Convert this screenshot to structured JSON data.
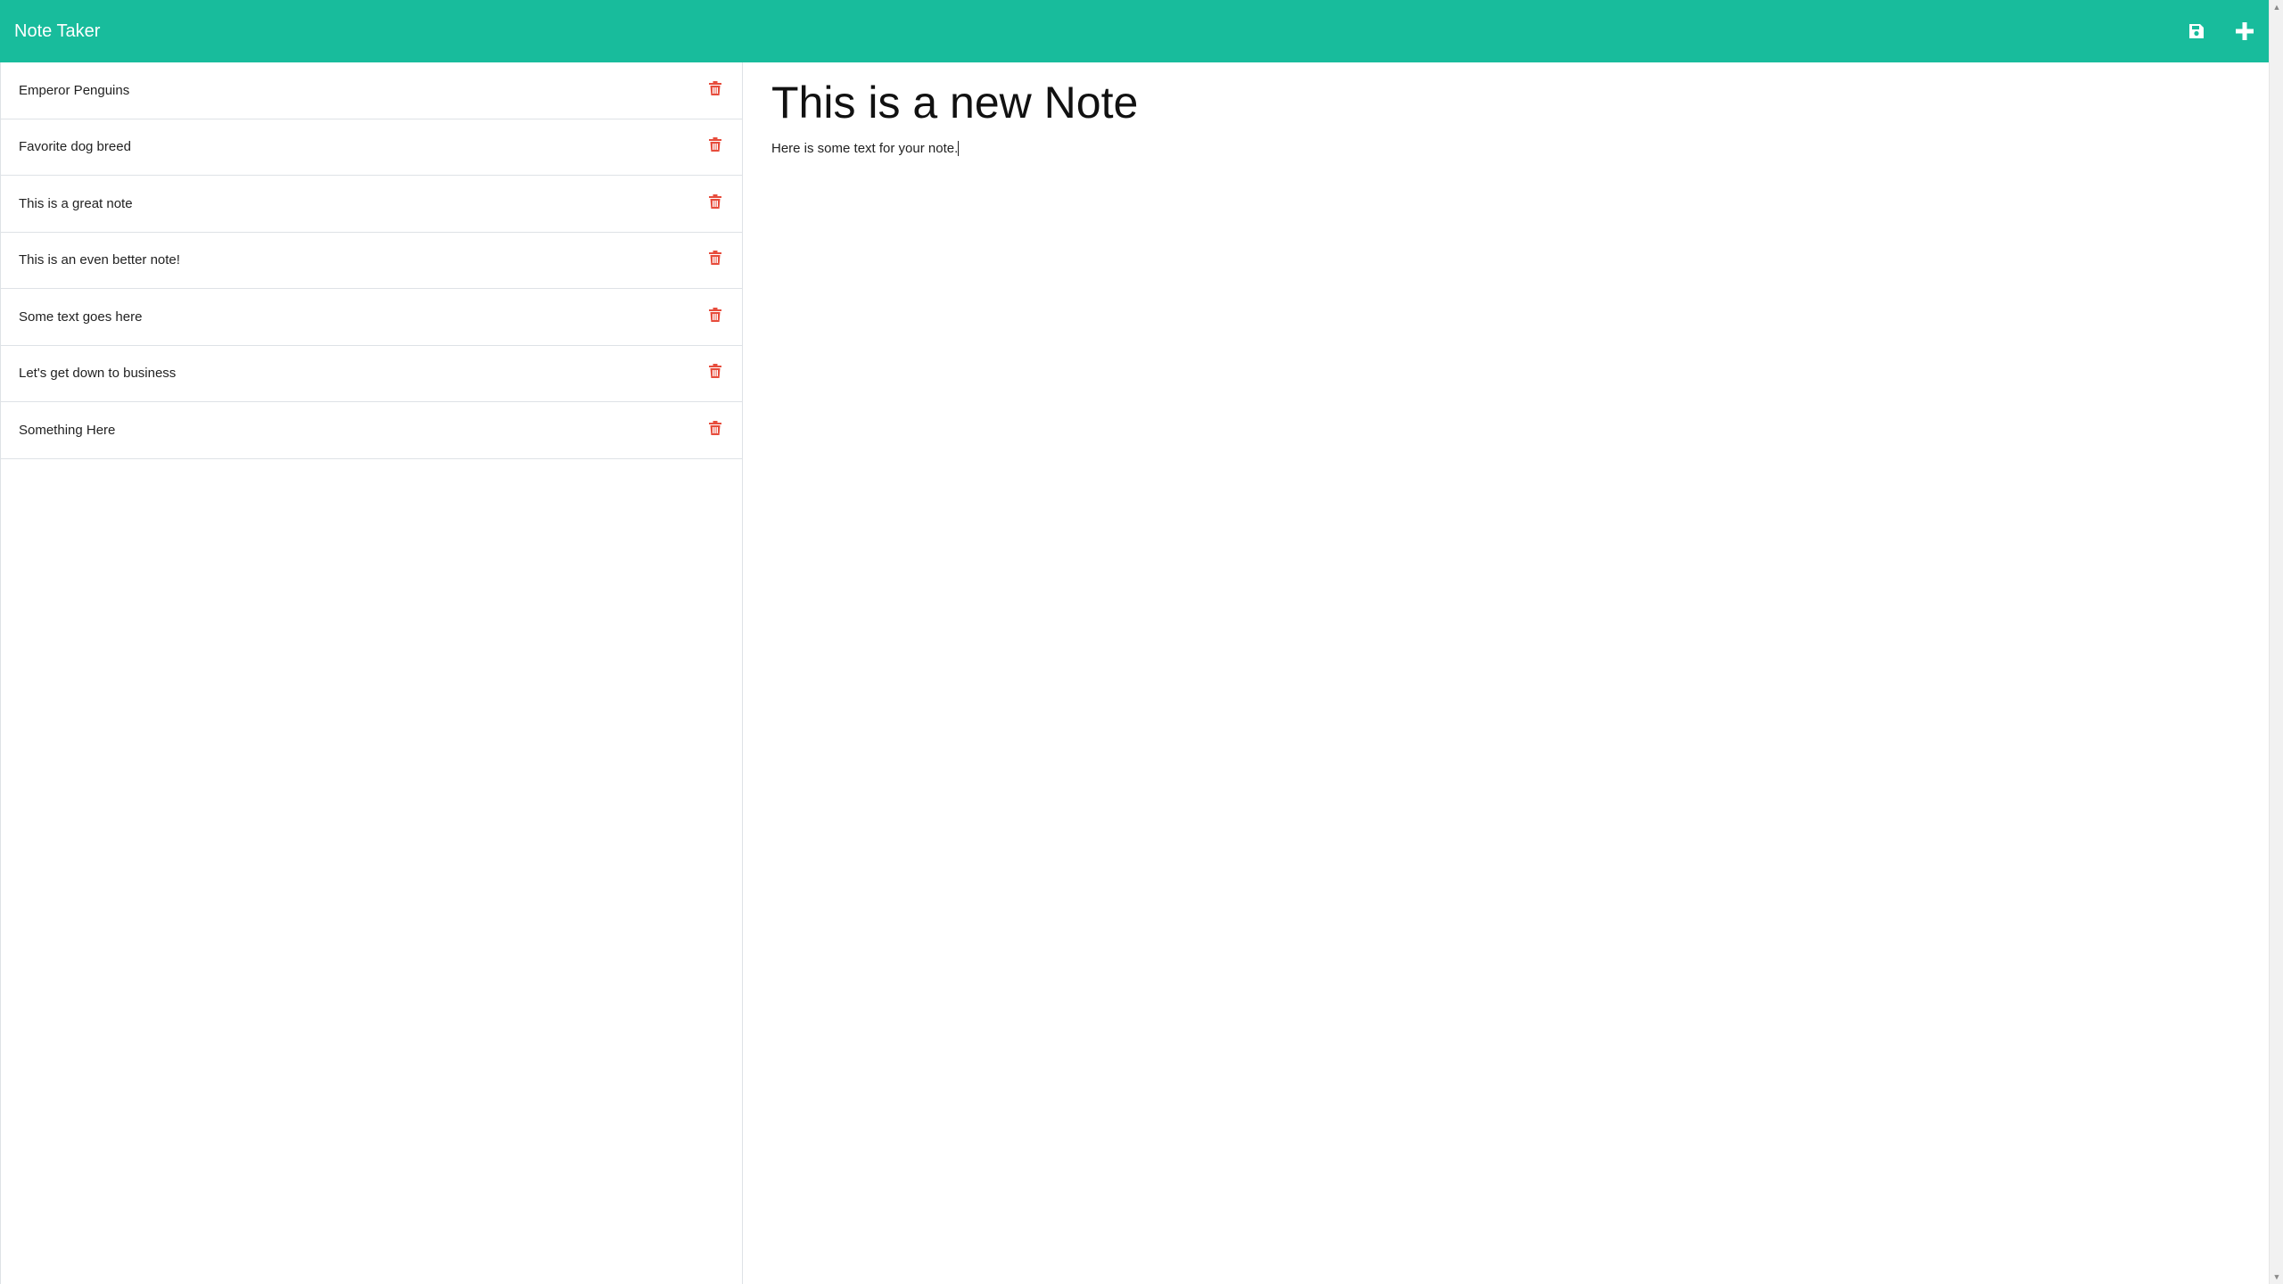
{
  "navbar": {
    "brand": "Note Taker",
    "save_icon": "save-icon",
    "new_icon": "plus-icon",
    "background": "#18bc9c"
  },
  "sidebar": {
    "notes": [
      {
        "title": "Emperor Penguins"
      },
      {
        "title": "Favorite dog breed"
      },
      {
        "title": "This is a great note"
      },
      {
        "title": "This is an even better note!"
      },
      {
        "title": "Some text goes here"
      },
      {
        "title": "Let's get down to business"
      },
      {
        "title": "Something Here"
      }
    ],
    "delete_icon": "trash-icon",
    "delete_color": "#e74c3c"
  },
  "editor": {
    "title_value": "This is a new Note",
    "body_value": "Here is some text for your note."
  }
}
